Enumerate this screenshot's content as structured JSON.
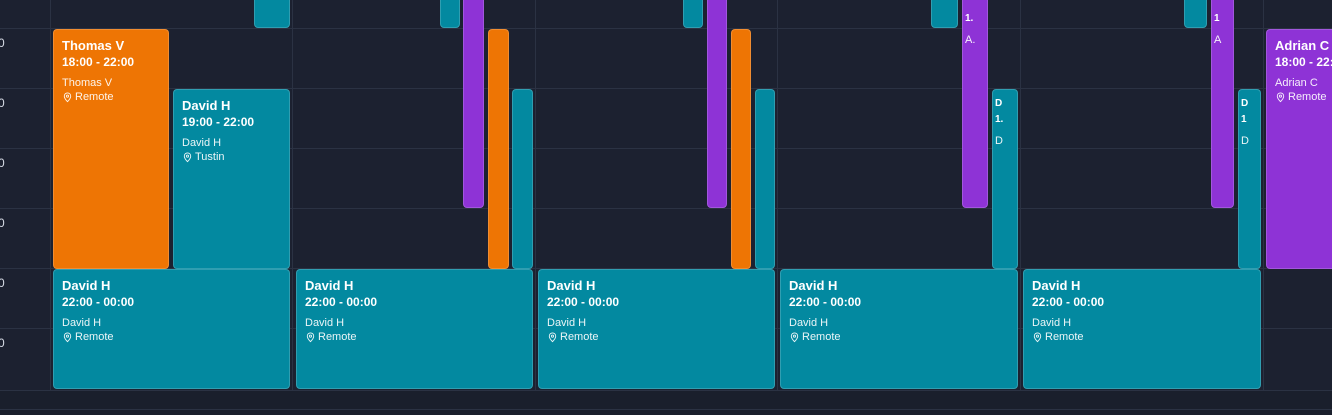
{
  "time_labels": [
    "0",
    "0",
    "0",
    "0",
    "0",
    "0"
  ],
  "colors": {
    "teal": "#0389a0",
    "orange": "#ee7504",
    "purple": "#8e33d6",
    "background": "#1c2130",
    "grid": "#2b3243"
  },
  "events": {
    "thomas": {
      "name": "Thomas V",
      "time": "18:00 - 22:00",
      "person": "Thomas V",
      "location": "Remote"
    },
    "david_tustin": {
      "name": "David H",
      "time": "19:00 - 22:00",
      "person": "David H",
      "location": "Tustin"
    },
    "adrian": {
      "name": "Adrian C",
      "time": "18:00 - 22:",
      "person": "Adrian C",
      "location": "Remote"
    },
    "david_remote": {
      "name": "David H",
      "time": "22:00 - 00:00",
      "person": "David H",
      "location": "Remote"
    },
    "narrow_d1": {
      "name": "D",
      "time": "1.",
      "person": "D"
    },
    "narrow_d2": {
      "name": "D",
      "time": "1",
      "person": "D"
    },
    "narrow_a": {
      "name": "1.",
      "person": "A."
    },
    "narrow_a2": {
      "name": "1",
      "person": "A"
    }
  }
}
